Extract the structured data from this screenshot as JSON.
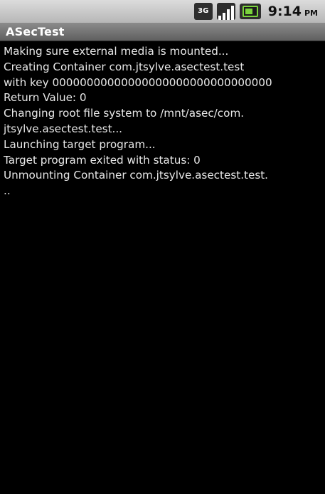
{
  "status_bar": {
    "network_type": "3G",
    "time": "9:14",
    "ampm": "PM"
  },
  "app": {
    "title": "ASecTest"
  },
  "log": {
    "lines": [
      "Making sure external media is mounted...",
      "Creating Container com.jtsylve.asectest.test",
      "with key 00000000000000000000000000000000",
      "Return Value: 0",
      "Changing root file system to /mnt/asec/com.",
      "jtsylve.asectest.test...",
      "Launching target program...",
      "Target program exited with status: 0",
      "Unmounting Container com.jtsylve.asectest.test.",
      ".."
    ]
  },
  "colors": {
    "background": "#000000",
    "status_bar": "#c8c8c8",
    "title_bar": "#6e6e6e",
    "battery": "#7ad33c"
  }
}
